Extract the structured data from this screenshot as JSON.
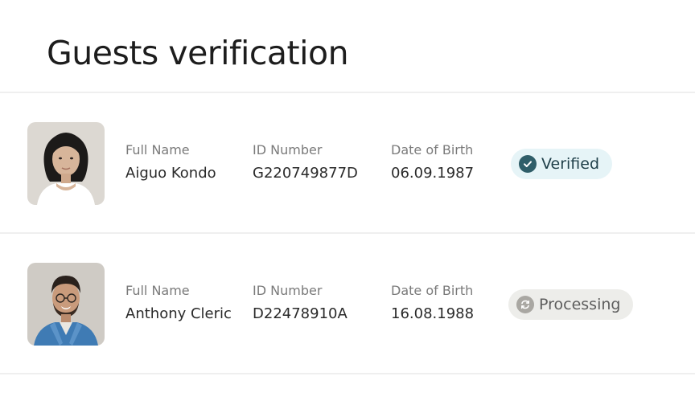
{
  "page": {
    "title": "Guests verification"
  },
  "guests": [
    {
      "full_name_label": "Full Name",
      "full_name": "Aiguo Kondo",
      "id_label": "ID Number",
      "id_number": "G220749877D",
      "dob_label": "Date of Birth",
      "dob": "06.09.1987",
      "status": "Verified",
      "status_icon": "check-circle-icon",
      "status_color": "#2f5e69"
    },
    {
      "full_name_label": "Full Name",
      "full_name": "Anthony Cleric",
      "id_label": "ID Number",
      "id_number": "D22478910A",
      "dob_label": "Date of Birth",
      "dob": "16.08.1988",
      "status": "Processing",
      "status_icon": "refresh-icon",
      "status_color": "#a9a7a2"
    }
  ]
}
